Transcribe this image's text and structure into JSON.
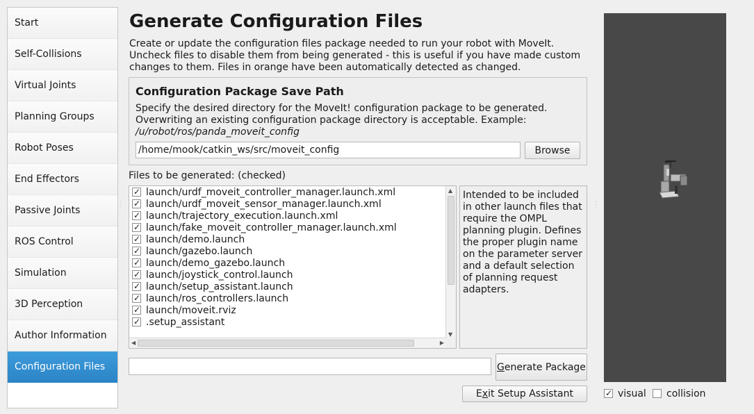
{
  "sidebar": {
    "items": [
      {
        "label": "Start"
      },
      {
        "label": "Self-Collisions"
      },
      {
        "label": "Virtual Joints"
      },
      {
        "label": "Planning Groups"
      },
      {
        "label": "Robot Poses"
      },
      {
        "label": "End Effectors"
      },
      {
        "label": "Passive Joints"
      },
      {
        "label": "ROS Control"
      },
      {
        "label": "Simulation"
      },
      {
        "label": "3D Perception"
      },
      {
        "label": "Author Information"
      },
      {
        "label": "Configuration Files"
      }
    ],
    "active_index": 11,
    "active_color": "#2f8fd4"
  },
  "main": {
    "title": "Generate Configuration Files",
    "description": "Create or update the configuration files package needed to run your robot with MoveIt. Uncheck files to disable them from being generated - this is useful if you have made custom changes to them. Files in orange have been automatically detected as changed.",
    "save_group": {
      "title": "Configuration Package Save Path",
      "description": "Specify the desired directory for the MoveIt! configuration package to be generated. Overwriting an existing configuration package directory is acceptable. Example: ",
      "example_path": "/u/robot/ros/panda_moveit_config",
      "path_value": "/home/mook/catkin_ws/src/moveit_config",
      "browse_label": "Browse"
    },
    "files_label": "Files to be generated: (checked)",
    "files": [
      {
        "name": "launch/urdf_moveit_controller_manager.launch.xml",
        "checked": true
      },
      {
        "name": "launch/urdf_moveit_sensor_manager.launch.xml",
        "checked": true
      },
      {
        "name": "launch/trajectory_execution.launch.xml",
        "checked": true
      },
      {
        "name": "launch/fake_moveit_controller_manager.launch.xml",
        "checked": true
      },
      {
        "name": "launch/demo.launch",
        "checked": true
      },
      {
        "name": "launch/gazebo.launch",
        "checked": true
      },
      {
        "name": "launch/demo_gazebo.launch",
        "checked": true
      },
      {
        "name": "launch/joystick_control.launch",
        "checked": true
      },
      {
        "name": "launch/setup_assistant.launch",
        "checked": true
      },
      {
        "name": "launch/ros_controllers.launch",
        "checked": true
      },
      {
        "name": "launch/moveit.rviz",
        "checked": true
      },
      {
        "name": ".setup_assistant",
        "checked": true
      }
    ],
    "file_info": "Intended to be included in other launch files that require the OMPL planning plugin. Defines the proper plugin name on the parameter server and a default selection of planning request adapters.",
    "status_value": "",
    "generate_label_mnemonic": "G",
    "generate_label_rest": "enerate Package",
    "exit_label_mnemonic": "x",
    "exit_label_pre": "E",
    "exit_label_rest": "it Setup Assistant"
  },
  "viewer": {
    "background": "#484848",
    "visual_label": "visual",
    "visual_checked": true,
    "collision_label": "collision",
    "collision_checked": false
  }
}
